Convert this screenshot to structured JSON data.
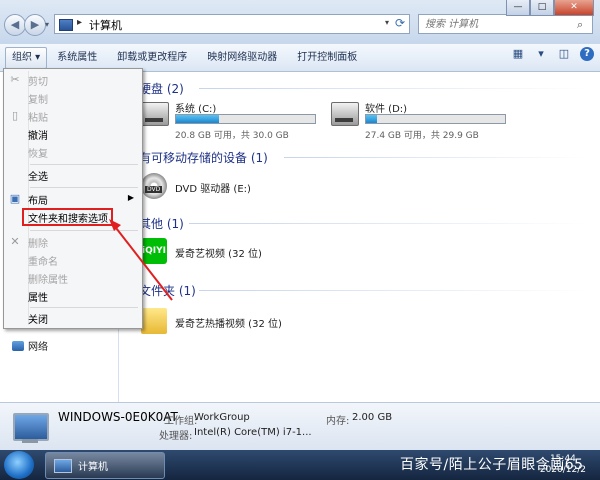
{
  "window": {
    "address_text": "计算机",
    "address_sep": "▸",
    "search_placeholder": "搜索 计算机",
    "minimize": "—",
    "maximize": "□",
    "close": "✕"
  },
  "toolbar": {
    "organize": "组织 ▾",
    "system_properties": "系统属性",
    "uninstall": "卸载或更改程序",
    "map_drive": "映射网络驱动器",
    "control_panel": "打开控制面板"
  },
  "groups": {
    "hard_disks": "硬盘 (2)",
    "removable": "有可移动存储的设备 (1)",
    "other": "其他 (1)",
    "folders": "文件夹 (1)"
  },
  "drives": [
    {
      "name": "系统 (C:)",
      "free": "20.8 GB 可用，共 30.0 GB",
      "used_fraction": 0.31
    },
    {
      "name": "软件 (D:)",
      "free": "27.4 GB 可用，共 29.9 GB",
      "used_fraction": 0.08
    }
  ],
  "items": {
    "dvd": "DVD 驱动器 (E:)",
    "dvd_tag": "DVD",
    "iqiyi": "爱奇艺视频 (32 位)",
    "iqiyi_logo": "iQIYI",
    "hot": "爱奇艺热播视频 (32 位)"
  },
  "navpane": {
    "network": "网络"
  },
  "menu": {
    "cut": "剪切",
    "copy": "复制",
    "paste": "粘贴",
    "undo": "撤消",
    "redo": "恢复",
    "select_all": "全选",
    "layout": "布局",
    "folder_options": "文件夹和搜索选项",
    "delete": "删除",
    "rename": "重命名",
    "remove_props": "删除属性",
    "properties": "属性",
    "close": "关闭"
  },
  "details": {
    "pc_name": "WINDOWS-0E0K0AT",
    "workgroup_label": "工作组:",
    "workgroup_value": "WorkGroup",
    "memory_label": "内存:",
    "memory_value": "2.00 GB",
    "cpu_label": "处理器:",
    "cpu_value": "Intel(R) Core(TM) i7-1..."
  },
  "taskbar": {
    "item": "计算机",
    "time": "15:44",
    "date": "2020/12/2"
  },
  "watermark": "百家号/陌上公子眉眼含画65",
  "colors": {
    "highlight": "#e02020",
    "group_header": "#1e3287",
    "drive_fill": "#1b86d0"
  }
}
